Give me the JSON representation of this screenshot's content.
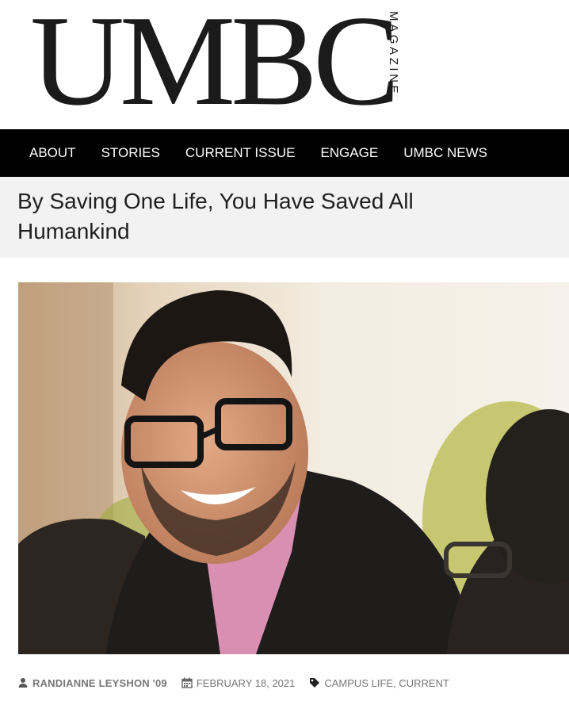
{
  "masthead": {
    "logo_word": "UMBC",
    "logo_side": "MAGAZINE"
  },
  "nav": {
    "items": [
      {
        "label": "ABOUT"
      },
      {
        "label": "STORIES"
      },
      {
        "label": "CURRENT ISSUE"
      },
      {
        "label": "ENGAGE"
      },
      {
        "label": "UMBC NEWS"
      }
    ]
  },
  "article": {
    "title": "By Saving One Life, You Have Saved All Humankind",
    "hero_icon": "photo-of-smiling-man-with-glasses",
    "meta": {
      "author": "RANDIANNE LEYSHON '09",
      "date": "FEBRUARY 18, 2021",
      "tags": [
        {
          "label": "CAMPUS LIFE"
        },
        {
          "label": "CURRENT"
        }
      ],
      "tag_separator": ", "
    }
  },
  "colors": {
    "nav_background": "#000000",
    "title_band": "#f2f2f2",
    "meta_text": "#777777"
  }
}
